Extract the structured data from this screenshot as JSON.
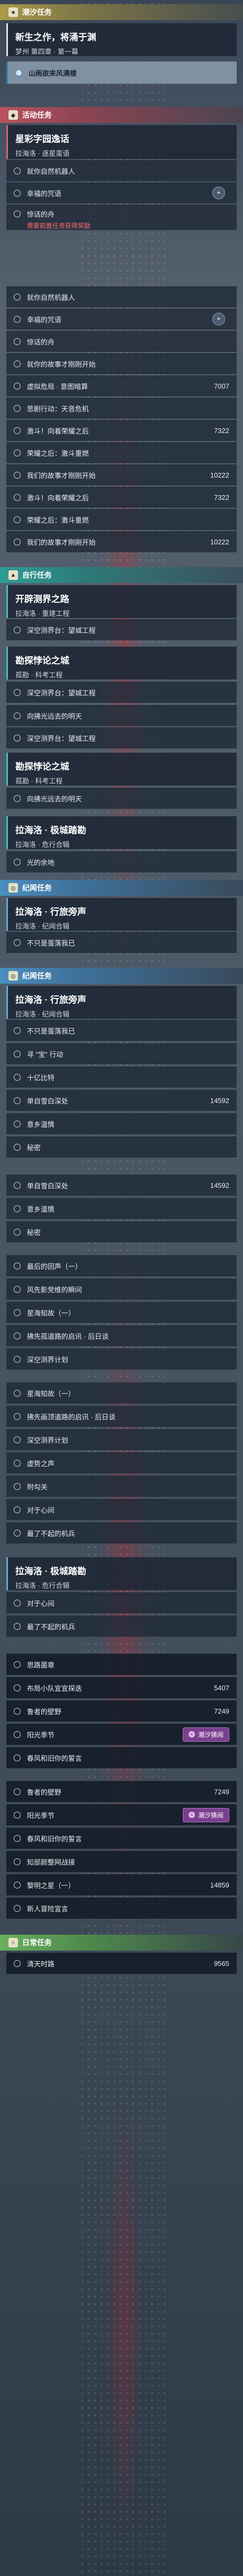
{
  "sections": {
    "chao_xi": {
      "title": "潮汐任务",
      "icon": "★"
    },
    "huodong": {
      "title": "活动任务",
      "icon": "◆"
    },
    "dianyu": {
      "title": "自行任务",
      "icon": "▲"
    },
    "jiming": {
      "title": "纪闻任务",
      "icon": "◎"
    },
    "jiming2": {
      "title": "纪闻任务",
      "icon": "◎"
    },
    "richang": {
      "title": "日常任务",
      "icon": "☼"
    }
  },
  "cards": {
    "c1": {
      "title": "新生之作，将涌于渊",
      "sub": "梦州 第四章 · 第一幕"
    },
    "c2": {
      "title": "星彩字园逸话",
      "sub": "拉海洛 · 逐星蛮语"
    },
    "c3": {
      "title": "开辟测界之路",
      "sub": "拉海洛 · 重建工程"
    },
    "c4": {
      "title": "勘探悖论之城",
      "sub": "孤勘 · 科考工程"
    },
    "c5": {
      "title": "勘探悖论之城",
      "sub": "孤勘 · 科考工程"
    },
    "c6": {
      "title": "拉海洛 · 极城踏勘",
      "sub": "拉海洛 · 危行合辑"
    },
    "c7": {
      "title": "拉海洛 · 行旅旁声",
      "sub": "拉海洛 · 纪闻合辑"
    },
    "c8": {
      "title": "拉海洛 · 行旅旁声",
      "sub": "拉海洛 · 纪闻合辑"
    },
    "c9": {
      "title": "拉海洛 · 极城踏勘",
      "sub": "拉海洛 · 危行合辑"
    }
  },
  "special": {
    "label": "山雨欲来风满楼"
  },
  "buttons": {
    "track": "追星贸易",
    "hot": "潮汐猜阅"
  },
  "warning": "需要前置任务获得奖励",
  "rows": {
    "r1": "就你自然机器人",
    "r2": "幸福的咒语",
    "r3": "惊话的舟",
    "r4": "就你自然机器人",
    "r5": "幸福的咒语",
    "r6": "惊话的舟",
    "r7": "就你的故事才刚刚开始",
    "r8": "虚拟危局 · 意图暗算",
    "r8n": "7007",
    "r9": "悲剧行动：天音危机",
    "r10": "激斗！向着荣耀之后",
    "r10n": "7322",
    "r11": "荣耀之后：激斗重燃",
    "r12": "我们的故事才刚刚开始",
    "r12n": "10222",
    "r13": "激斗！向着荣耀之后",
    "r13n": "7322",
    "r14": "荣耀之后：激斗重燃",
    "r15": "我们的故事才刚刚开始",
    "r15n": "10222",
    "r16": "深空测界台：望城工程",
    "r17": "深空测界台：望城工程",
    "r18": "向拂光远去的明天",
    "r19": "深空测界台：望城工程",
    "r20": "向拂光远去的明天",
    "r21": "光的余地",
    "r22": "不只是蛋落我已",
    "r23": "不只是蛋落我已",
    "r24": "寻 \"宝\" 行动",
    "r25": "十亿比特",
    "r26": "单自雪白深处",
    "r26n": "14592",
    "r27": "意乡温情",
    "r28": "秘密",
    "r29": "单自雪白深处",
    "r29n": "14592",
    "r30": "意乡温情",
    "r31": "秘密",
    "r32": "最后的回声（一）",
    "r33": "风先影党维的瞬间",
    "r34": "星海知故（一）",
    "r35": "拂先孤道路的启讯 · 后日谈",
    "r36": "深空测界计划",
    "r37": "星海知故（一）",
    "r38": "拂先画顶道路的启讯 · 后日谈",
    "r39": "深空测界计划",
    "r40": "虚势之声",
    "r41": "附勾关",
    "r42": "对于心间",
    "r43": "最了不起的机兵",
    "r44": "对于心间",
    "r45": "最了不起的机兵",
    "r46": "思路菌章",
    "r47": "布局小队宜宜探迭",
    "r47n": "5407",
    "r48": "鲁者的壁野",
    "r48n": "7249",
    "r49": "阳光季节",
    "r50": "春风和旧你的誓言",
    "r51": "鲁者的壁野",
    "r51n": "7249",
    "r52": "阳光季节",
    "r53": "春风和旧你的誓言",
    "r54": "知部颜整网战接",
    "r55": "黎明之星（一）",
    "r55n": "14859",
    "r56": "新人冒险宣言",
    "r57": "清天时路",
    "r57n": "9565"
  }
}
